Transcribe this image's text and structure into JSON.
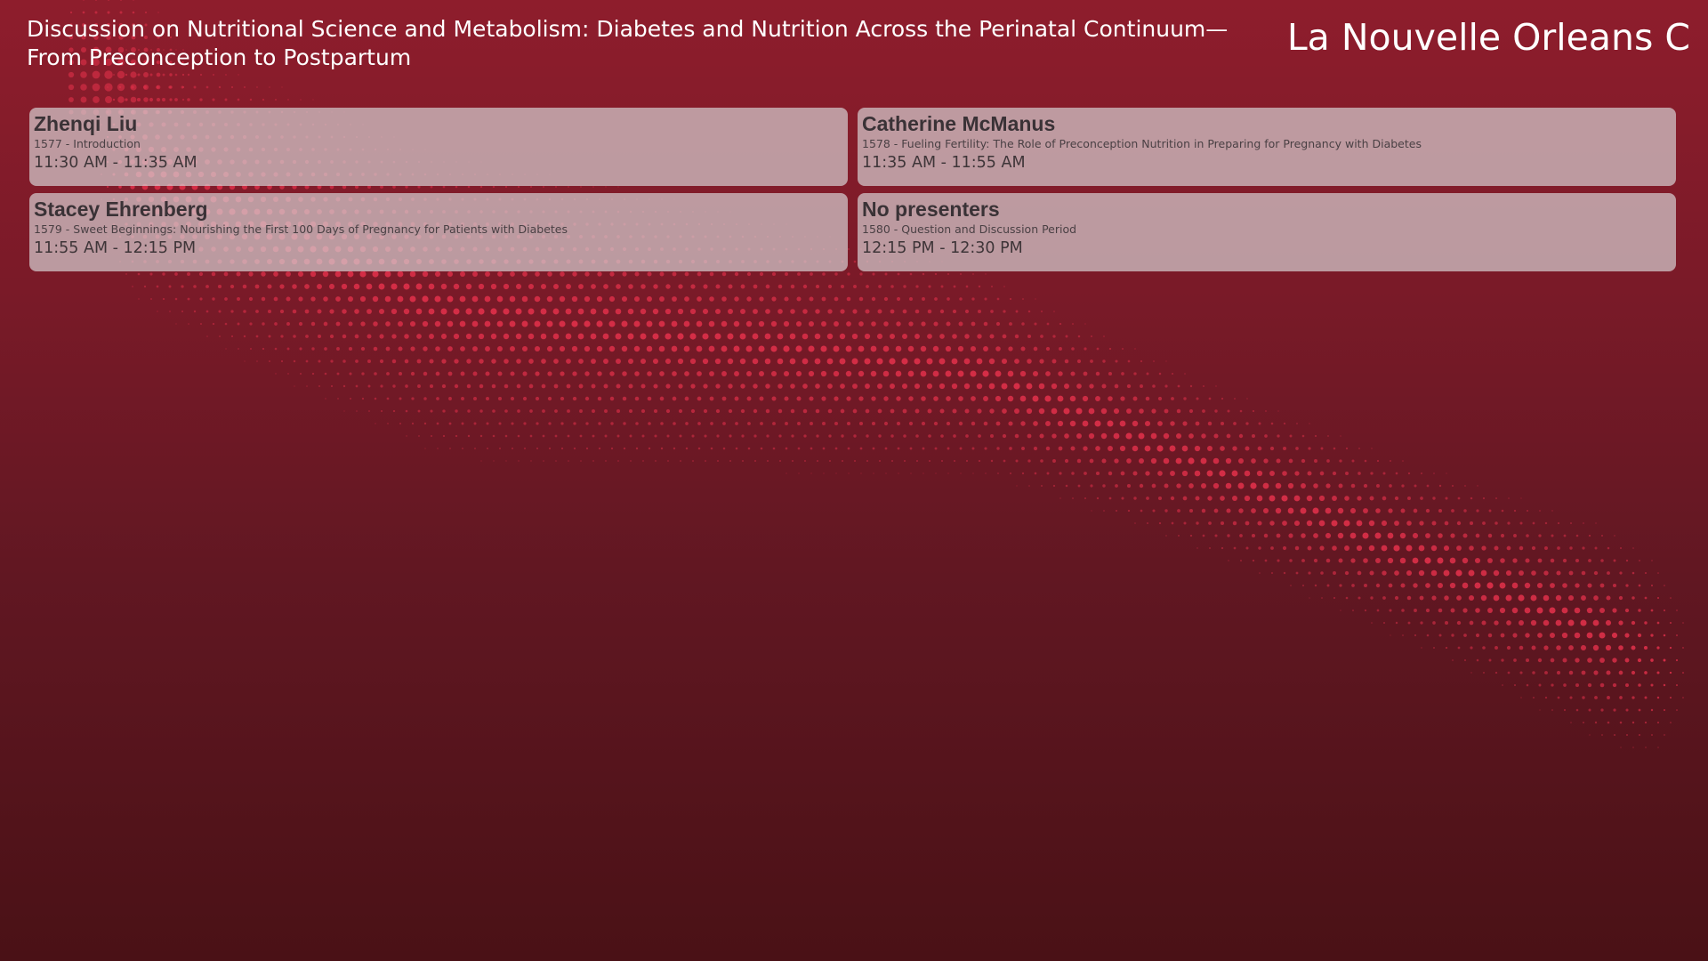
{
  "header": {
    "session_title": "Discussion on Nutritional Science and Metabolism: Diabetes and Nutrition Across the Perinatal Continuum—From Preconception to Postpartum",
    "room": "La Nouvelle Orleans C"
  },
  "presentations": [
    {
      "presenter": "Zhenqi Liu",
      "abstract": "1577 - Introduction",
      "time": "11:30 AM - 11:35 AM"
    },
    {
      "presenter": "Catherine McManus",
      "abstract": "1578 - Fueling Fertility: The Role of Preconception Nutrition in Preparing for Pregnancy with Diabetes",
      "time": "11:35 AM - 11:55 AM"
    },
    {
      "presenter": "Stacey Ehrenberg",
      "abstract": "1579 - Sweet Beginnings: Nourishing the First 100 Days of Pregnancy for Patients with Diabetes",
      "time": "11:55 AM - 12:15 PM"
    },
    {
      "presenter": "No presenters",
      "abstract": "1580 - Question and Discussion Period",
      "time": "12:15 PM - 12:30 PM"
    }
  ],
  "colors": {
    "background_top": "#8e1d2c",
    "background_bottom": "#4a1116",
    "dot_pattern": "#e0304a",
    "card_background": "#d4ccce",
    "text_primary": "#ffffff",
    "card_text": "#3a3236"
  }
}
